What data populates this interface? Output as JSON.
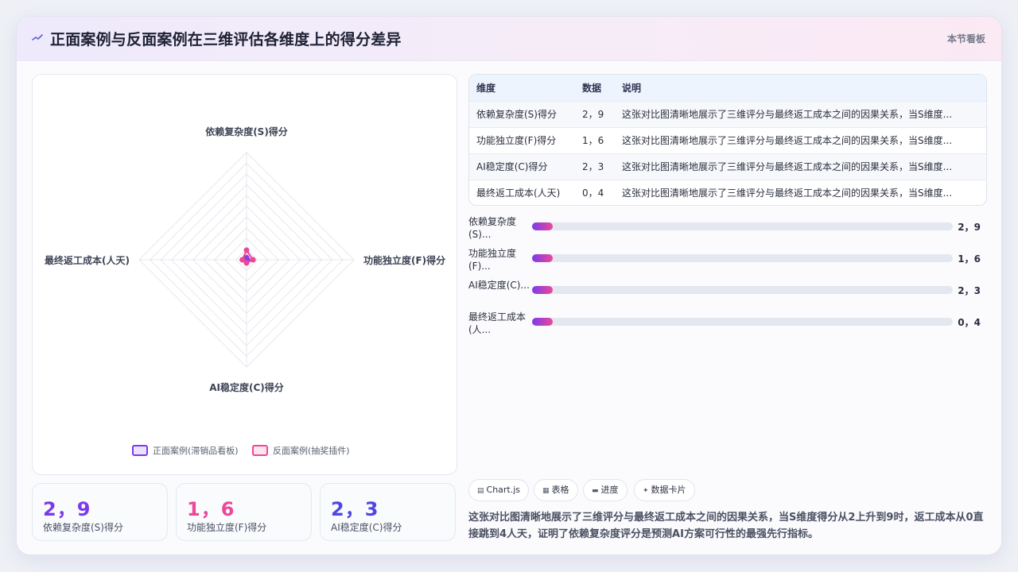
{
  "header": {
    "title": "正面案例与反面案例在三维评估各维度上的得分差异",
    "nav_label": "本节看板"
  },
  "chart_data": {
    "type": "radar",
    "axes": [
      "依赖复杂度(S)得分",
      "功能独立度(F)得分",
      "AI稳定度(C)得分",
      "最终返工成本(人天)"
    ],
    "series": [
      {
        "name": "正面案例(滞销品看板)",
        "color": "#7c3aed",
        "values": [
          2,
          1,
          2,
          0
        ]
      },
      {
        "name": "反面案例(抽奖插件)",
        "color": "#ec4899",
        "values": [
          9,
          6,
          3,
          4
        ]
      }
    ],
    "rmax": 100,
    "grid_levels": 10
  },
  "stats": [
    {
      "value": "2，9",
      "label": "依赖复杂度(S)得分",
      "color": "#7c3aed"
    },
    {
      "value": "1，6",
      "label": "功能独立度(F)得分",
      "color": "#ec4899"
    },
    {
      "value": "2，3",
      "label": "AI稳定度(C)得分",
      "color": "#4f46e5"
    }
  ],
  "table": {
    "headers": [
      "维度",
      "数据",
      "说明"
    ],
    "rows": [
      [
        "依赖复杂度(S)得分",
        "2，9",
        "这张对比图清晰地展示了三维评分与最终返工成本之间的因果关系，当S维度..."
      ],
      [
        "功能独立度(F)得分",
        "1，6",
        "这张对比图清晰地展示了三维评分与最终返工成本之间的因果关系，当S维度..."
      ],
      [
        "AI稳定度(C)得分",
        "2，3",
        "这张对比图清晰地展示了三维评分与最终返工成本之间的因果关系，当S维度..."
      ],
      [
        "最终返工成本(人天)",
        "0，4",
        "这张对比图清晰地展示了三维评分与最终返工成本之间的因果关系，当S维度..."
      ]
    ]
  },
  "bars": [
    {
      "label": "依赖复杂度(S)...",
      "value": "2，9",
      "fill_percent": 5
    },
    {
      "label": "功能独立度(F)...",
      "value": "1，6",
      "fill_percent": 5
    },
    {
      "label": "AI稳定度(C)...",
      "value": "2，3",
      "fill_percent": 5
    },
    {
      "label": "最终返工成本(人...",
      "value": "0，4",
      "fill_percent": 5
    }
  ],
  "chips": [
    {
      "icon": "chart-icon",
      "glyph": "▤",
      "label": "Chart.js"
    },
    {
      "icon": "table-icon",
      "glyph": "▦",
      "label": "表格"
    },
    {
      "icon": "progress-icon",
      "glyph": "▬",
      "label": "进度"
    },
    {
      "icon": "sparkle-icon",
      "glyph": "✦",
      "label": "数据卡片"
    }
  ],
  "description": "这张对比图清晰地展示了三维评分与最终返工成本之间的因果关系，当S维度得分从2上升到9时，返工成本从0直接跳到4人天，证明了依赖复杂度评分是预测AI方案可行性的最强先行指标。"
}
